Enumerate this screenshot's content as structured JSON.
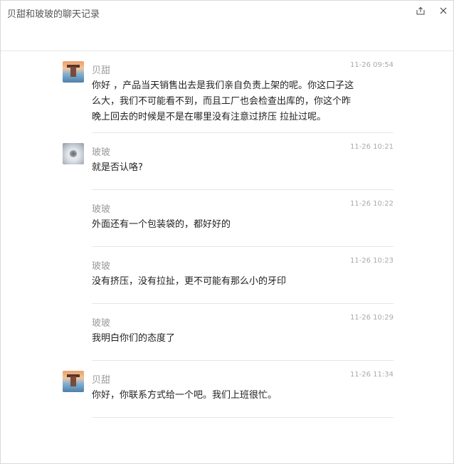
{
  "window": {
    "title": "贝甜和玻玻的聊天记录"
  },
  "messages": [
    {
      "sender": "贝甜",
      "time": "11-26 09:54",
      "avatar_icon": "sunset-pavilion-avatar",
      "show_avatar": true,
      "lines": [
        "你好 ，产品当天销售出去是我们亲自负责上架的呢。你这口子这",
        "么大，我们不可能看不到，而且工厂也会检查出库的，你这个昨",
        "晚上回去的时候是不是在哪里没有注意过挤压 拉扯过呢。"
      ]
    },
    {
      "sender": "玻玻",
      "time": "11-26 10:21",
      "avatar_icon": "snow-avatar",
      "show_avatar": true,
      "lines": [
        "就是否认咯?"
      ]
    },
    {
      "sender": "玻玻",
      "time": "11-26 10:22",
      "show_avatar": false,
      "lines": [
        "外面还有一个包装袋的，都好好的"
      ]
    },
    {
      "sender": "玻玻",
      "time": "11-26 10:23",
      "show_avatar": false,
      "lines": [
        "没有挤压，没有拉扯，更不可能有那么小的牙印"
      ]
    },
    {
      "sender": "玻玻",
      "time": "11-26 10:29",
      "show_avatar": false,
      "lines": [
        "我明白你们的态度了"
      ]
    },
    {
      "sender": "贝甜",
      "time": "11-26 11:34",
      "avatar_icon": "sunset-pavilion-avatar",
      "show_avatar": true,
      "lines": [
        "你好，你联系方式给一个吧。我们上班很忙。"
      ]
    }
  ]
}
